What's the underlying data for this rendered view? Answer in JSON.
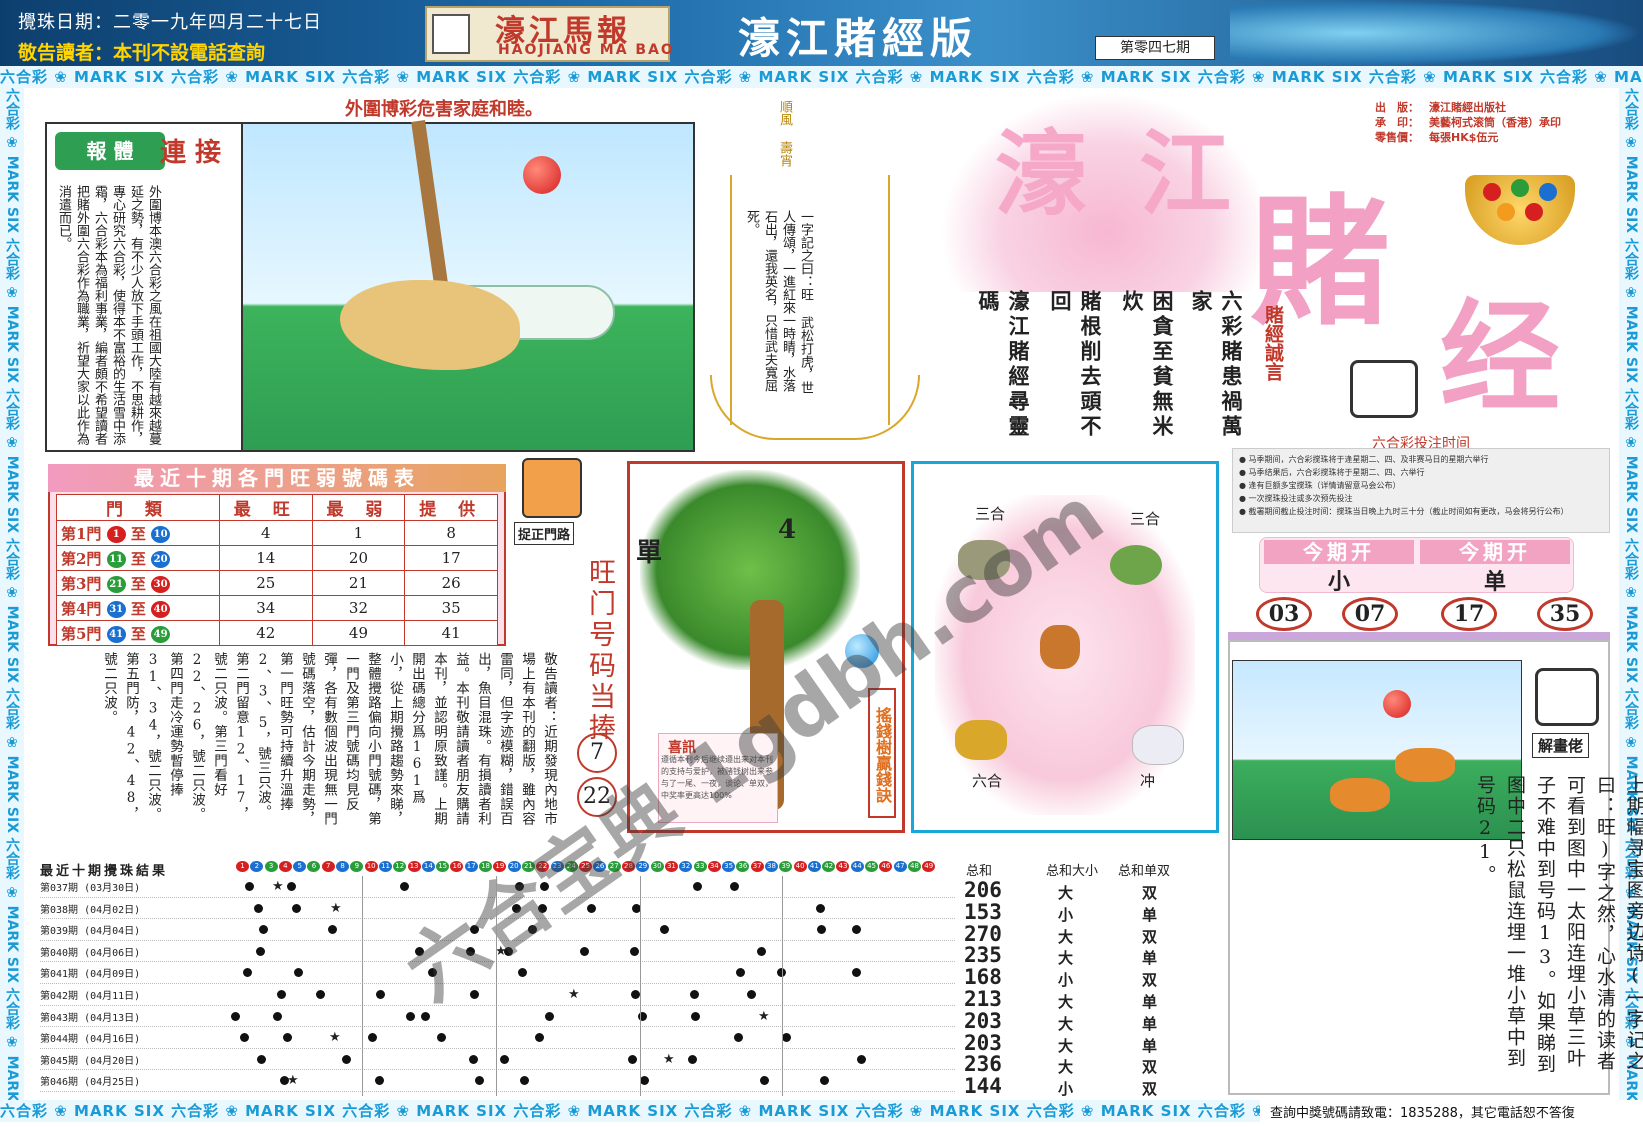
{
  "header": {
    "draw_date": "攪珠日期：二零一九年四月二十七日",
    "notice": "敬告讀者：本刊不設電話查詢",
    "logo_cn": "濠江馬報",
    "logo_en": "HAOJIANG MA BAO",
    "edition_title": "濠江賭經版",
    "issue_no": "第零四七期"
  },
  "strip_text": "六合彩 ❀ MARK SIX 六合彩 ❀ MARK SIX 六合彩 ❀ MARK SIX 六合彩 ❀ MARK SIX 六合彩 ❀ MARK SIX 六合彩 ❀ MARK SIX 六合彩 ❀ MARK SIX 六合彩 ❀ MARK SIX 六合彩 ❀ MARK SIX 六合彩 ❀ MARK SIX",
  "comic1": {
    "headline": "外圍博彩危害家庭和睦。",
    "badge": "報 體",
    "title": "連 接",
    "article": "外圍博本澳六合彩之風在祖國大陸有越來越蔓延之勢，有不少人放下手頭工作，不思耕作，專心研究六合彩，使得本不富裕的生活雪中添霜，六合彩本為福利事業，編者頗不希望讀者把賭外圍六合彩作為職業，祈望大家以此作為消遣而已。"
  },
  "sailboat": {
    "flag_text": "順風 壽宵",
    "poem": "一字記之曰：旺 武松打虎，世人傳頌，一進紅來一時睛，水落石出，還我英名，只惜武夫寬屈死。"
  },
  "logo": {
    "big1": "濠 江",
    "big2": "賭",
    "big3": "经",
    "publisher": [
      {
        "label": "出　版：",
        "value": "濠江賭經出版社"
      },
      {
        "label": "承　印：",
        "value": "美藝柯式滚筒（香港）承印"
      },
      {
        "label": "零售價：",
        "value": "每張HK$伍元"
      }
    ],
    "motto": "賭經誠言",
    "poem": [
      "六彩賭患禍萬家",
      "困貪至貧無米炊",
      "賭根削去頭不回",
      "濠江賭經尋靈碼"
    ]
  },
  "bet_time": {
    "title": "六合彩投注时间",
    "lines": [
      "● 马季期间，六合彩搅珠将于逢星期二、四、及非赛马日的星期六举行",
      "● 马季结果后，六合彩搅珠将于星期二、四、六举行",
      "● 逢有巨额多宝搅珠（详情请留意马会公布）",
      "● 一次搅珠投注或多次预先投注",
      "● 截署期间截止投注时间：搅珠当日晚上九时三十分（截止时间如有更改，马会将另行公布）"
    ]
  },
  "door_table": {
    "title": "最近十期各門旺弱號碼表",
    "headers": [
      "門 類",
      "最 旺",
      "最 弱",
      "提 供"
    ],
    "rows": [
      {
        "door": "第1門",
        "from": "1",
        "to": "10",
        "from_color": "#d62020",
        "to_color": "#1a6fd1",
        "max": "4",
        "min": "1",
        "offer": "8"
      },
      {
        "door": "第2門",
        "from": "11",
        "to": "20",
        "from_color": "#2a9d3a",
        "to_color": "#1a6fd1",
        "max": "14",
        "min": "20",
        "offer": "17"
      },
      {
        "door": "第3門",
        "from": "21",
        "to": "30",
        "from_color": "#2a9d3a",
        "to_color": "#d62020",
        "max": "25",
        "min": "21",
        "offer": "26"
      },
      {
        "door": "第4門",
        "from": "31",
        "to": "40",
        "from_color": "#1a6fd1",
        "to_color": "#d62020",
        "max": "34",
        "min": "32",
        "offer": "35"
      },
      {
        "door": "第5門",
        "from": "41",
        "to": "49",
        "from_color": "#1a6fd1",
        "to_color": "#2a9d3a",
        "max": "42",
        "min": "49",
        "offer": "41"
      }
    ]
  },
  "right_door": {
    "label": "捉正門路",
    "title": "旺门号码当捧",
    "n1": "7",
    "n2": "22"
  },
  "article_mid": "敬告讀者：近期發現內地市場上有本刊的翻版，雖內容雷同，但字迹模糊，錯誤百出，魚目混珠。有損讀者利益。本刊敬請讀者朋友購請本刊，並認明原致謹。上期開出碼總分爲161爲小，從上期攪路趨勢來睇，整體攪路偏向小門號碼，第一門及第三門號碼均見反彈，各有數個波出現無一門號碼落空，估計今期走勢，第一門旺勢可持續升溫捧2、3、5，號三只波。第二門留意12、17，號二只波。第三門看好22、26，號二只波。第四門走冷運勢暫停捧31、34，號二只波。第五門防，42、48，號二只波。",
  "tree": {
    "single": "單",
    "four": "4",
    "joy_title": "喜訊",
    "joy_text": "遵循本刊今后继续遵出来对本刊的支持与爱护，被赌钱树出来参与了一尾、一夜，谈论、单双，中奖率更高达100%",
    "money_tree": "搖錢樹贏錢訣"
  },
  "zodiac": {
    "tl": "三合",
    "tr": "三合",
    "bl": "六合",
    "br": "冲"
  },
  "this_period": {
    "head": "今期开",
    "size": "小",
    "odd": "单",
    "numbers": [
      "03",
      "07",
      "17",
      "35"
    ]
  },
  "comic2": {
    "label": "解畫佬",
    "poem": "上期幅寻宝图旁边诗(一字记之曰：旺)字之然，心水清的读者可看到图中一太阳连埋小草三叶子不难中到号码13。如果睇到图中二只松鼠连埋一堆小草中到号码21。"
  },
  "results": {
    "title": "最近十期攪珠結果",
    "sum_head": "总和",
    "size_head": "总和大小",
    "odd_head": "总和单双",
    "rows": [
      {
        "label": "第037期 (03月30日)",
        "sum": "206",
        "size": "大",
        "odd": "双"
      },
      {
        "label": "第038期 (04月02日)",
        "sum": "153",
        "size": "小",
        "odd": "单"
      },
      {
        "label": "第039期 (04月04日)",
        "sum": "270",
        "size": "大",
        "odd": "双"
      },
      {
        "label": "第040期 (04月06日)",
        "sum": "235",
        "size": "大",
        "odd": "单"
      },
      {
        "label": "第041期 (04月09日)",
        "sum": "168",
        "size": "小",
        "odd": "双"
      },
      {
        "label": "第042期 (04月11日)",
        "sum": "213",
        "size": "大",
        "odd": "单"
      },
      {
        "label": "第043期 (04月13日)",
        "sum": "203",
        "size": "大",
        "odd": "单"
      },
      {
        "label": "第044期 (04月16日)",
        "sum": "203",
        "size": "大",
        "odd": "单"
      },
      {
        "label": "第045期 (04月20日)",
        "sum": "236",
        "size": "大",
        "odd": "双"
      },
      {
        "label": "第046期 (04月25日)",
        "sum": "144",
        "size": "小",
        "odd": "双"
      }
    ]
  },
  "query_footer": "查詢中獎號碼請致電：1835288，其它電話恕不答復",
  "watermark": "六合宝典 1gdbh.com",
  "colors": {
    "red": "#d62020",
    "blue": "#1a6fd1",
    "green": "#2a9d3a",
    "accent_pink": "#f2a3c1",
    "frame_cyan": "#1a9bd6"
  }
}
